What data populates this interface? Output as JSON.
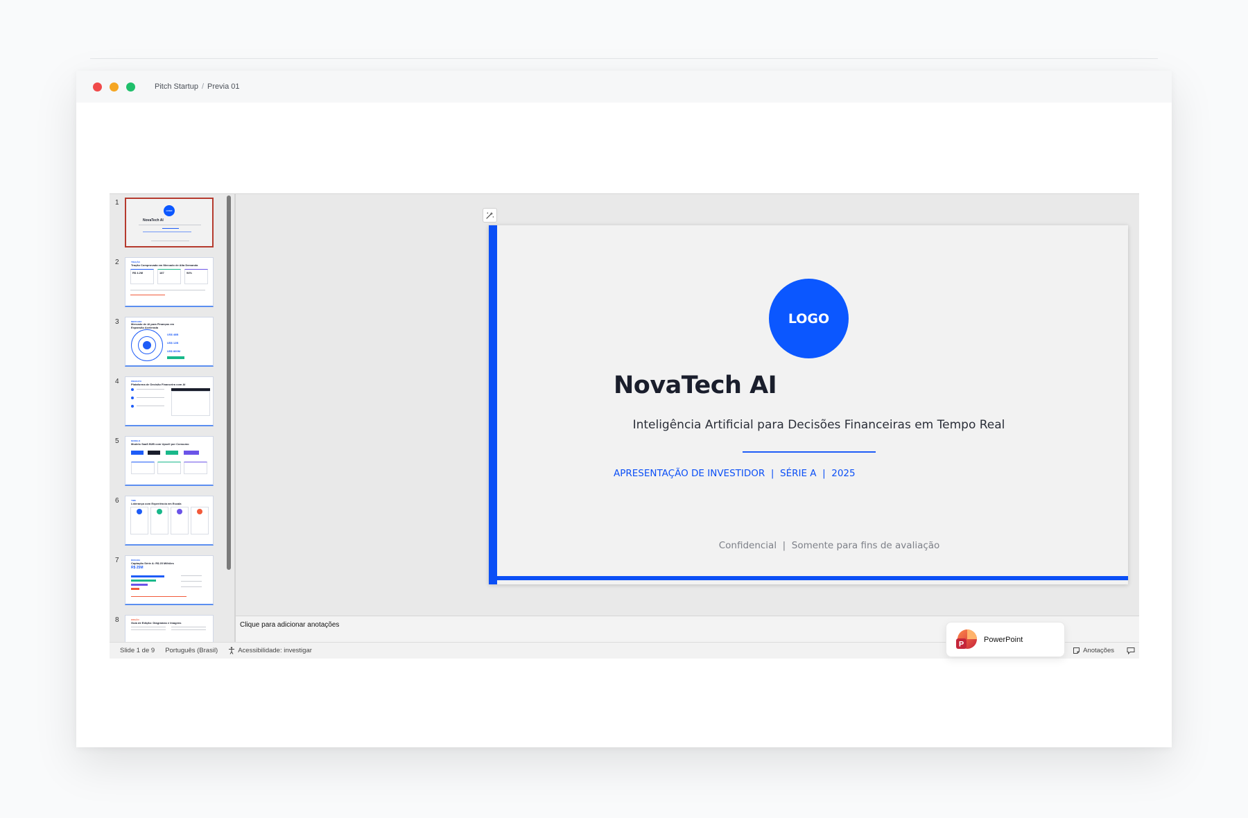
{
  "window": {
    "breadcrumb": [
      "Pitch Startup",
      "Previa 01"
    ],
    "breadcrumb_sep": "/"
  },
  "thumbnails": {
    "numbers": [
      "1",
      "2",
      "3",
      "4",
      "5",
      "6",
      "7",
      "8"
    ],
    "active_index": 1,
    "items": [
      {
        "title": "NovaTech AI",
        "logo": "LOGO"
      },
      {
        "tag": "TRAÇÃO",
        "title": "Tração Comprovada em Mercado de Alta Demanda",
        "stats": [
          "R$ 4.2M",
          "187",
          "94%"
        ]
      },
      {
        "tag": "MERCADO",
        "title": "Mercado de AI para Finanças em Expansão Acelerada",
        "stats": [
          "US$ 48B",
          "US$ 12B",
          "US$ 800M"
        ]
      },
      {
        "tag": "PRODUTO",
        "title": "Plataforma de Decisão Financeira com AI"
      },
      {
        "tag": "MODELO",
        "title": "Modelo SaaS B2B com Upsell por Consumo"
      },
      {
        "tag": "TIME",
        "title": "Liderança com Experiência em Escala"
      },
      {
        "tag": "RODADA",
        "title": "Captação Série A: R$ 25 Milhões",
        "stats": [
          "R$ 25M"
        ]
      },
      {
        "tag": "EDIÇÃO",
        "title": "Guia de Edição: Diagramas e Imagens"
      }
    ]
  },
  "slide": {
    "logo": "LOGO",
    "title": "NovaTech AI",
    "subtitle": "Inteligência Artificial para Decisões Financeiras em Tempo Real",
    "meta": "APRESENTAÇÃO DE INVESTIDOR  |  SÉRIE A  |  2025",
    "confidential": "Confidencial  |  Somente para fins de avaliação"
  },
  "notes": {
    "placeholder": "Clique para adicionar anotações"
  },
  "status": {
    "slide": "Slide 1 de 9",
    "language": "Português (Brasil)",
    "accessibility": "Acessibilidade: investigar",
    "notes_button": "Anotações"
  },
  "app_badge": {
    "label": "PowerPoint"
  },
  "colors": {
    "accent": "#0b4ff6",
    "active_thumb_border": "#b53a2e",
    "close": "#f04a4a",
    "minimize": "#f5a623",
    "maximize": "#1fbf6b"
  },
  "icons": [
    "designer-icon",
    "accessibility-icon",
    "notes-icon",
    "comments-icon",
    "powerpoint-logo-icon"
  ]
}
